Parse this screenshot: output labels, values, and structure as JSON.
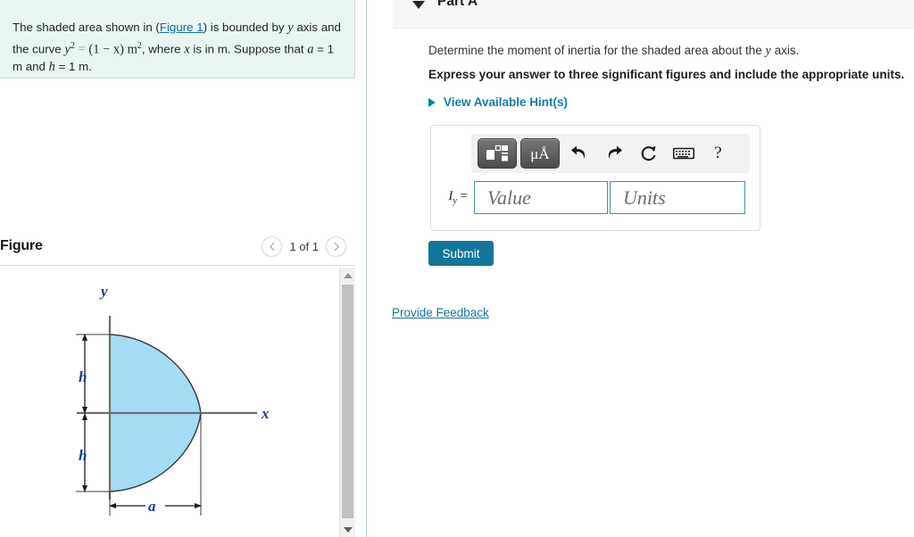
{
  "problem": {
    "text_part1": "The shaded area shown in (",
    "figure_link": "Figure 1",
    "text_part2": ") is bounded by ",
    "var_y": "y",
    "text_part3": " axis and the curve ",
    "equation_y": "y",
    "equation_sup": "2",
    "equation_eq": "=",
    "equation_rhs": "(1 − x) m",
    "equation_rhs_sup": "2",
    "text_part4": ", where ",
    "var_x": "x",
    "text_part5": " is in m. Suppose that ",
    "var_a": "a",
    "text_a_val": " = 1 m and ",
    "var_h": "h",
    "text_h_val": " = 1 m."
  },
  "figure_panel": {
    "title": "Figure",
    "pager_prev_icon": "chevron-left-icon",
    "pager_next_icon": "chevron-right-icon",
    "pager_count": "1 of 1"
  },
  "part": {
    "caret_icon": "caret-down-icon",
    "title": "Part A",
    "question": "Determine the moment of inertia for the shaded area about the ",
    "question_var": "y",
    "question_tail": " axis.",
    "express": "Express your answer to three significant figures and include the appropriate units.",
    "hints_caret_icon": "caret-right-icon",
    "hints_label": "View Available Hint(s)"
  },
  "toolbar": {
    "template_icon": "math-template-icon",
    "units_icon": "micro-angstrom-units-icon",
    "units_label": "μÅ",
    "undo_icon": "undo-arrow-icon",
    "redo_icon": "redo-arrow-icon",
    "reset_icon": "reset-circular-arrow-icon",
    "keyboard_icon": "keyboard-icon",
    "help_icon": "question-mark-icon",
    "help_label": "?"
  },
  "answer": {
    "label": "I",
    "label_sub": "y",
    "label_eq": "=",
    "value_placeholder": "Value",
    "units_placeholder": "Units",
    "value": "",
    "units": ""
  },
  "actions": {
    "submit_label": "Submit",
    "feedback_label": "Provide Feedback"
  },
  "scrollbar": {
    "up_icon": "scroll-up-arrow-icon",
    "down_icon": "scroll-down-arrow-icon"
  },
  "figure": {
    "axis_y_label": "y",
    "axis_x_label": "x",
    "dim_h_top": "h",
    "dim_h_bottom": "h",
    "dim_a": "a",
    "shade_color": "#a5dcf5",
    "outline_color": "#3d3d3d",
    "label_color": "#1f3a93"
  },
  "colors": {
    "accent": "#12769a",
    "link": "#1a6aa8",
    "problem_bg": "#e8f5f2",
    "header_bg": "#f7f7f7",
    "input_border": "#4a8fa8"
  }
}
